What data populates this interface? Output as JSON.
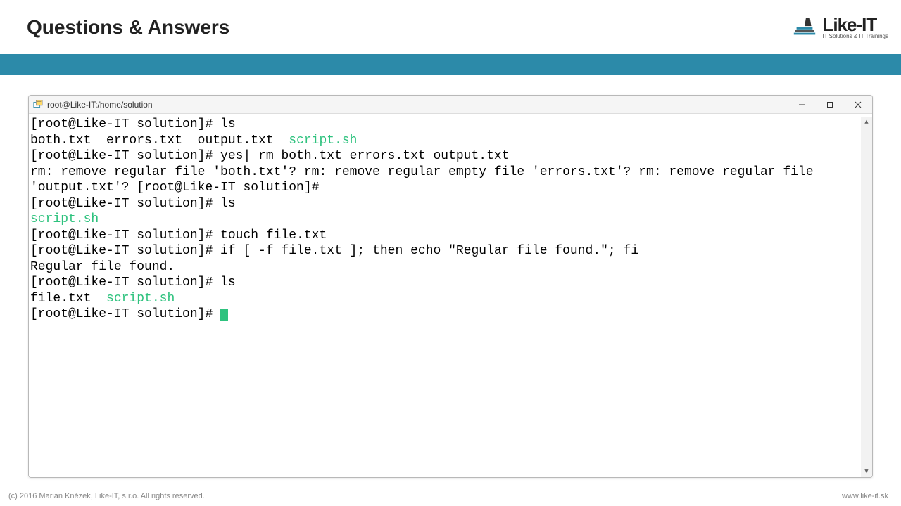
{
  "header": {
    "title": "Questions & Answers",
    "logo_name": "Like-IT",
    "logo_tagline": "IT Solutions & IT Trainings"
  },
  "window": {
    "title": "root@Like-IT:/home/solution"
  },
  "terminal": {
    "prompt": "[root@Like-IT solution]# ",
    "lines": [
      {
        "type": "cmd",
        "text": "ls"
      },
      {
        "type": "out-mixed",
        "parts": [
          {
            "c": "n",
            "t": "both.txt  errors.txt  output.txt  "
          },
          {
            "c": "exe",
            "t": "script.sh"
          }
        ]
      },
      {
        "type": "cmd",
        "text": "yes| rm both.txt errors.txt output.txt"
      },
      {
        "type": "out",
        "text": "rm: remove regular file 'both.txt'? rm: remove regular empty file 'errors.txt'? rm: remove regular file 'output.txt'? [root@Like-IT solution]#"
      },
      {
        "type": "cmd",
        "text": "ls"
      },
      {
        "type": "out-mixed",
        "parts": [
          {
            "c": "exe",
            "t": "script.sh"
          }
        ]
      },
      {
        "type": "cmd",
        "text": "touch file.txt"
      },
      {
        "type": "cmd",
        "text": "if [ -f file.txt ]; then echo \"Regular file found.\"; fi"
      },
      {
        "type": "out",
        "text": "Regular file found."
      },
      {
        "type": "cmd",
        "text": "ls"
      },
      {
        "type": "out-mixed",
        "parts": [
          {
            "c": "n",
            "t": "file.txt  "
          },
          {
            "c": "exe",
            "t": "script.sh"
          }
        ]
      },
      {
        "type": "cursor"
      }
    ]
  },
  "footer": {
    "copyright": "(c) 2016 Marián Knězek, Like-IT, s.r.o. All rights reserved.",
    "url": "www.like-it.sk"
  }
}
